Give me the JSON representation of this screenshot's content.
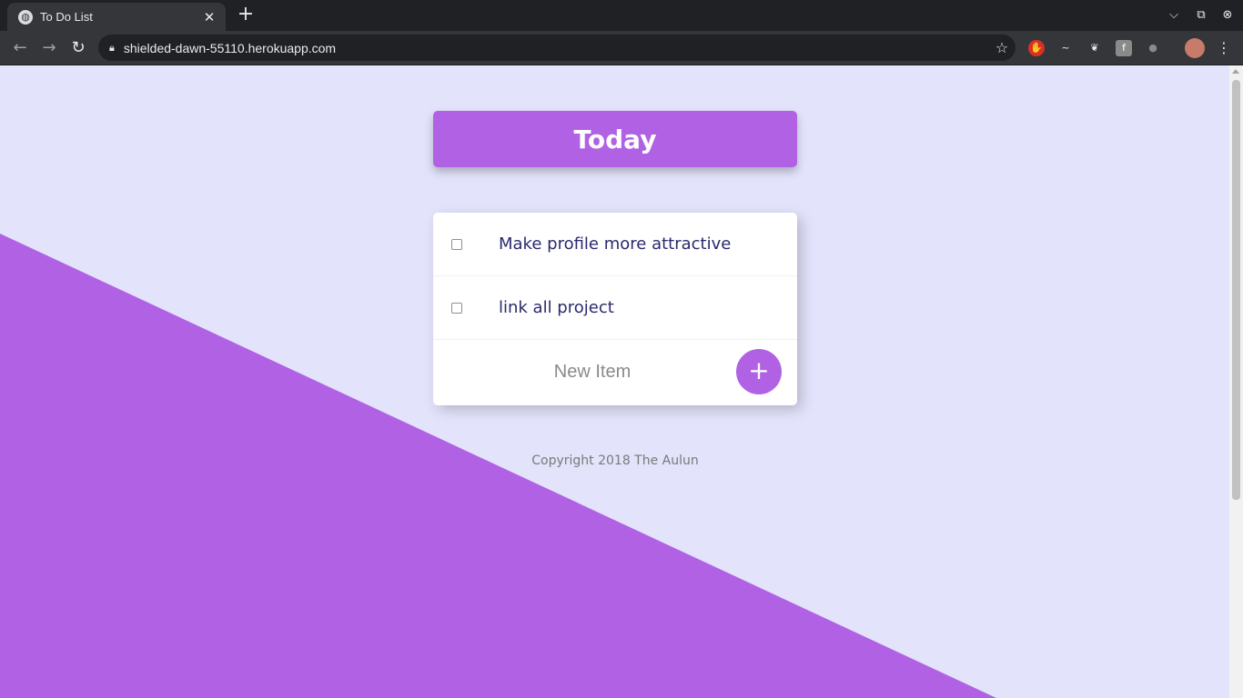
{
  "browser": {
    "tab_title": "To Do List",
    "tab_close": "✕",
    "new_tab": "+",
    "url": "shielded-dawn-55110.herokuapp.com"
  },
  "app": {
    "heading": "Today",
    "items": [
      {
        "text": "Make profile more attractive",
        "checked": false
      },
      {
        "text": "link all project",
        "checked": false
      }
    ],
    "new_item_placeholder": "New Item",
    "add_button_label": "+",
    "footer": "Copyright 2018 The Aulun"
  },
  "colors": {
    "accent": "#b162e4",
    "background": "#e3e3fb",
    "item_text": "#2a2a6e"
  }
}
